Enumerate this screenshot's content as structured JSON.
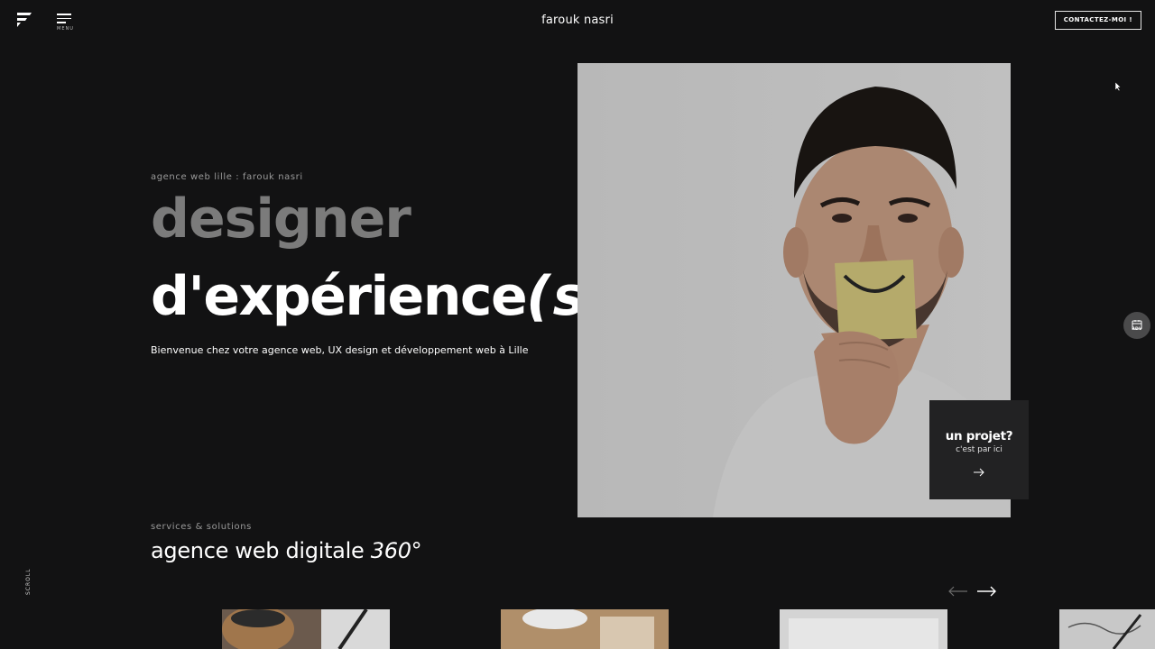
{
  "header": {
    "brand": "farouk nasri",
    "menu_label": "MENU",
    "contact_button": "CONTACTEZ-MOI !"
  },
  "hero": {
    "kicker": "agence web lille : farouk nasri",
    "headline_1": "designer",
    "headline_2": "d'expérience",
    "headline_2_suffix": "(s)",
    "intro": "Bienvenue chez votre agence web, UX design et développement web à Lille"
  },
  "project_card": {
    "title": "un projet?",
    "subtitle": "c'est par ici"
  },
  "rdv": {
    "label": "RDV"
  },
  "services": {
    "kicker": "services & solutions",
    "title": "agence web digitale",
    "title_accent": "360°"
  },
  "scroll": {
    "label": "SCROLL"
  },
  "colors": {
    "background": "#121213",
    "muted_headline": "#7b7b7b",
    "card": "#222223",
    "rdv_button": "#4a4a4b"
  },
  "icons": {
    "logo": "f-logo-icon",
    "menu": "hamburger-menu-icon",
    "rdv": "calendar-icon",
    "prev": "arrow-left-icon",
    "next": "arrow-right-icon",
    "project": "arrow-right-icon"
  }
}
